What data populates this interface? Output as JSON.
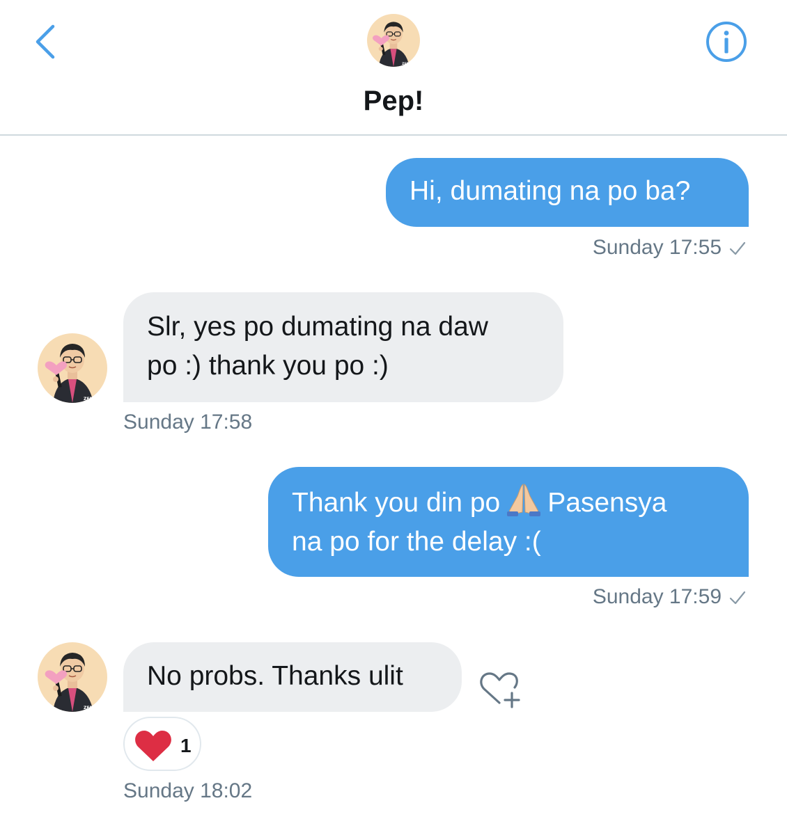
{
  "header": {
    "title": "Pep!",
    "back_icon": "chevron-left-icon",
    "info_icon": "info-circle-icon",
    "accent_color": "#4a9fe8"
  },
  "messages": [
    {
      "direction": "outgoing",
      "text": "Hi, dumating na po ba?",
      "timestamp": "Sunday 17:55",
      "status_icon": "check-icon"
    },
    {
      "direction": "incoming",
      "line1": "Slr, yes po dumating na daw",
      "line2": "po :) thank you po :)",
      "timestamp": "Sunday 17:58"
    },
    {
      "direction": "outgoing",
      "line1_before_emoji": "Thank you din po",
      "emoji": "🙏🏼",
      "line1_after_emoji": "Pasensya",
      "line2": "na po for the delay :(",
      "timestamp": "Sunday 17:59",
      "status_icon": "check-icon"
    },
    {
      "direction": "incoming",
      "text": "No probs. Thanks ulit",
      "timestamp": "Sunday 18:02",
      "reaction": {
        "icon": "heart-icon",
        "count": "1",
        "color": "#dd2e44"
      },
      "react_icon": "heart-add-icon"
    }
  ],
  "colors": {
    "outgoing_bubble": "#4a9fe8",
    "incoming_bubble": "#eceef0",
    "timestamp": "#657786"
  }
}
